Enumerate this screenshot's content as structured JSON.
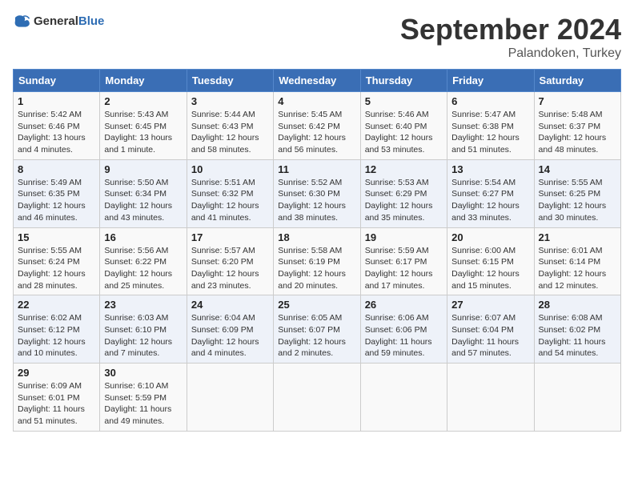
{
  "header": {
    "logo_general": "General",
    "logo_blue": "Blue",
    "month_title": "September 2024",
    "location": "Palandoken, Turkey"
  },
  "days_of_week": [
    "Sunday",
    "Monday",
    "Tuesday",
    "Wednesday",
    "Thursday",
    "Friday",
    "Saturday"
  ],
  "weeks": [
    [
      {
        "day": 1,
        "sunrise": "5:42 AM",
        "sunset": "6:46 PM",
        "daylight": "13 hours and 4 minutes"
      },
      {
        "day": 2,
        "sunrise": "5:43 AM",
        "sunset": "6:45 PM",
        "daylight": "13 hours and 1 minute"
      },
      {
        "day": 3,
        "sunrise": "5:44 AM",
        "sunset": "6:43 PM",
        "daylight": "12 hours and 58 minutes"
      },
      {
        "day": 4,
        "sunrise": "5:45 AM",
        "sunset": "6:42 PM",
        "daylight": "12 hours and 56 minutes"
      },
      {
        "day": 5,
        "sunrise": "5:46 AM",
        "sunset": "6:40 PM",
        "daylight": "12 hours and 53 minutes"
      },
      {
        "day": 6,
        "sunrise": "5:47 AM",
        "sunset": "6:38 PM",
        "daylight": "12 hours and 51 minutes"
      },
      {
        "day": 7,
        "sunrise": "5:48 AM",
        "sunset": "6:37 PM",
        "daylight": "12 hours and 48 minutes"
      }
    ],
    [
      {
        "day": 8,
        "sunrise": "5:49 AM",
        "sunset": "6:35 PM",
        "daylight": "12 hours and 46 minutes"
      },
      {
        "day": 9,
        "sunrise": "5:50 AM",
        "sunset": "6:34 PM",
        "daylight": "12 hours and 43 minutes"
      },
      {
        "day": 10,
        "sunrise": "5:51 AM",
        "sunset": "6:32 PM",
        "daylight": "12 hours and 41 minutes"
      },
      {
        "day": 11,
        "sunrise": "5:52 AM",
        "sunset": "6:30 PM",
        "daylight": "12 hours and 38 minutes"
      },
      {
        "day": 12,
        "sunrise": "5:53 AM",
        "sunset": "6:29 PM",
        "daylight": "12 hours and 35 minutes"
      },
      {
        "day": 13,
        "sunrise": "5:54 AM",
        "sunset": "6:27 PM",
        "daylight": "12 hours and 33 minutes"
      },
      {
        "day": 14,
        "sunrise": "5:55 AM",
        "sunset": "6:25 PM",
        "daylight": "12 hours and 30 minutes"
      }
    ],
    [
      {
        "day": 15,
        "sunrise": "5:55 AM",
        "sunset": "6:24 PM",
        "daylight": "12 hours and 28 minutes"
      },
      {
        "day": 16,
        "sunrise": "5:56 AM",
        "sunset": "6:22 PM",
        "daylight": "12 hours and 25 minutes"
      },
      {
        "day": 17,
        "sunrise": "5:57 AM",
        "sunset": "6:20 PM",
        "daylight": "12 hours and 23 minutes"
      },
      {
        "day": 18,
        "sunrise": "5:58 AM",
        "sunset": "6:19 PM",
        "daylight": "12 hours and 20 minutes"
      },
      {
        "day": 19,
        "sunrise": "5:59 AM",
        "sunset": "6:17 PM",
        "daylight": "12 hours and 17 minutes"
      },
      {
        "day": 20,
        "sunrise": "6:00 AM",
        "sunset": "6:15 PM",
        "daylight": "12 hours and 15 minutes"
      },
      {
        "day": 21,
        "sunrise": "6:01 AM",
        "sunset": "6:14 PM",
        "daylight": "12 hours and 12 minutes"
      }
    ],
    [
      {
        "day": 22,
        "sunrise": "6:02 AM",
        "sunset": "6:12 PM",
        "daylight": "12 hours and 10 minutes"
      },
      {
        "day": 23,
        "sunrise": "6:03 AM",
        "sunset": "6:10 PM",
        "daylight": "12 hours and 7 minutes"
      },
      {
        "day": 24,
        "sunrise": "6:04 AM",
        "sunset": "6:09 PM",
        "daylight": "12 hours and 4 minutes"
      },
      {
        "day": 25,
        "sunrise": "6:05 AM",
        "sunset": "6:07 PM",
        "daylight": "12 hours and 2 minutes"
      },
      {
        "day": 26,
        "sunrise": "6:06 AM",
        "sunset": "6:06 PM",
        "daylight": "11 hours and 59 minutes"
      },
      {
        "day": 27,
        "sunrise": "6:07 AM",
        "sunset": "6:04 PM",
        "daylight": "11 hours and 57 minutes"
      },
      {
        "day": 28,
        "sunrise": "6:08 AM",
        "sunset": "6:02 PM",
        "daylight": "11 hours and 54 minutes"
      }
    ],
    [
      {
        "day": 29,
        "sunrise": "6:09 AM",
        "sunset": "6:01 PM",
        "daylight": "11 hours and 51 minutes"
      },
      {
        "day": 30,
        "sunrise": "6:10 AM",
        "sunset": "5:59 PM",
        "daylight": "11 hours and 49 minutes"
      },
      null,
      null,
      null,
      null,
      null
    ]
  ]
}
